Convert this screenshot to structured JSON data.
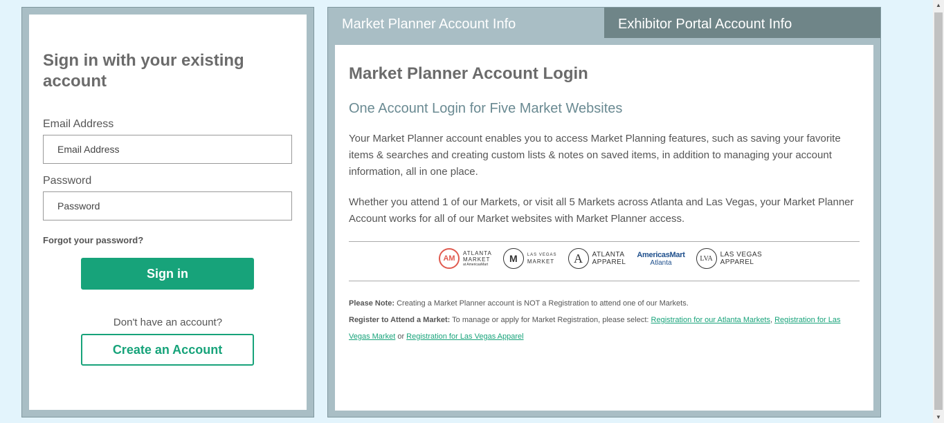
{
  "signin": {
    "title": "Sign in with your existing account",
    "email_label": "Email Address",
    "email_placeholder": "Email Address",
    "email_value": "",
    "password_label": "Password",
    "password_placeholder": "Password",
    "password_value": "",
    "forgot_link": "Forgot your password?",
    "signin_button": "Sign in",
    "no_account_text": "Don't have an account?",
    "create_button": "Create an Account",
    "accent_color": "#17a37a"
  },
  "tabs": [
    {
      "label": "Market Planner Account Info",
      "active": true
    },
    {
      "label": "Exhibitor Portal Account Info",
      "active": false
    }
  ],
  "info": {
    "title": "Market Planner Account Login",
    "subtitle": "One Account Login for Five Market Websites",
    "para1": "Your Market Planner account enables you to access Market Planning features, such as saving your favorite items & searches and creating custom lists & notes on saved items, in addition to managing your account information, all in one place.",
    "para2": "Whether you attend 1 of our Markets, or visit all 5 Markets across Atlanta and Las Vegas, your Market Planner Account works for all of our Market websites with Market Planner access.",
    "logos": [
      {
        "icon": "atlanta-market-logo",
        "mark": "AM",
        "line1": "ATLANTA",
        "line2": "MARKET",
        "line3": "at AmericasMart"
      },
      {
        "icon": "las-vegas-market-logo",
        "mark": "M",
        "line1": "LAS VEGAS",
        "line2": "MARKET"
      },
      {
        "icon": "atlanta-apparel-logo",
        "mark": "A",
        "line1": "ATLANTA",
        "line2": "APPAREL"
      },
      {
        "icon": "americasmart-logo",
        "line1": "AmericasMart",
        "line2": "Atlanta"
      },
      {
        "icon": "las-vegas-apparel-logo",
        "mark": "LVA",
        "line1": "LAS VEGAS",
        "line2": "APPAREL"
      }
    ],
    "note_label": "Please Note:",
    "note_text": " Creating a Market Planner account is NOT a Registration to attend one of our Markets.",
    "register_label": "Register to Attend a Market:",
    "register_text": " To manage or apply for Market Registration, please select: ",
    "link_atlanta": "Registration for our Atlanta Markets",
    "sep1": ", ",
    "link_lv_market": "Registration for Las Vegas Market",
    "sep2": " or ",
    "link_lv_apparel": "Registration for Las Vegas Apparel"
  }
}
